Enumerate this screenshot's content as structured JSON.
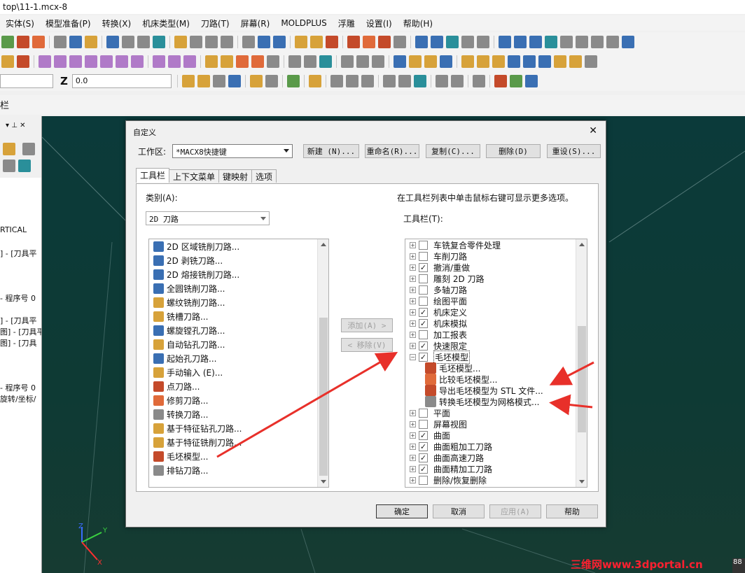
{
  "title": "top\\11-1.mcx-8",
  "menu": [
    "实体(S)",
    "模型准备(P)",
    "转换(X)",
    "机床类型(M)",
    "刀路(T)",
    "屏幕(R)",
    "MOLDPLUS",
    "浮雕",
    "设置(I)",
    "帮助(H)"
  ],
  "toolbar3": {
    "z_label": "Z",
    "z_value": "0.0"
  },
  "toolbar_strip_label": "栏",
  "left_panel": {
    "items": [
      "RTICAL",
      "]  - [刀具平",
      "- 程序号 0",
      "]  - [刀具平",
      "图] - [刀具平",
      "图] - [刀具",
      "- 程序号 0",
      "旋转/坐标/"
    ]
  },
  "dialog": {
    "title": "自定义",
    "workspace_label": "工作区:",
    "workspace_value": "*MACX8快捷键",
    "buttons": {
      "new": "新建 (N)...",
      "rename": "重命名(R)...",
      "copy": "复制(C)...",
      "delete": "删除(D)",
      "reset": "重设(S)..."
    },
    "tabs": [
      "工具栏",
      "上下文菜单",
      "键映射",
      "选项"
    ],
    "category_label": "类别(A):",
    "category_value": "2D 刀路",
    "hint": "在工具栏列表中单击鼠标右键可显示更多选项。",
    "toolbars_label": "工具栏(T):",
    "add": "添加(A) >",
    "remove": "< 移除(V)",
    "commands": [
      {
        "label": "2D 区域铣削刀路...",
        "icon": "area-mill-icon"
      },
      {
        "label": "2D 剥铣刀路...",
        "icon": "peel-mill-icon"
      },
      {
        "label": "2D 熔接铣削刀路...",
        "icon": "blend-mill-icon"
      },
      {
        "label": "全圆铣削刀路...",
        "icon": "circle-mill-icon"
      },
      {
        "label": "螺纹铣削刀路...",
        "icon": "thread-mill-icon"
      },
      {
        "label": "铣槽刀路...",
        "icon": "slot-mill-icon"
      },
      {
        "label": "螺旋镗孔刀路...",
        "icon": "helix-bore-icon"
      },
      {
        "label": "自动钻孔刀路...",
        "icon": "auto-drill-icon"
      },
      {
        "label": "起始孔刀路...",
        "icon": "start-hole-icon"
      },
      {
        "label": "手动输入 (E)...",
        "icon": "manual-entry-icon"
      },
      {
        "label": "点刀路...",
        "icon": "point-toolpath-icon"
      },
      {
        "label": "修剪刀路...",
        "icon": "trim-toolpath-icon"
      },
      {
        "label": "转换刀路...",
        "icon": "transform-toolpath-icon"
      },
      {
        "label": "基于特征钻孔刀路...",
        "icon": "fbm-drill-icon"
      },
      {
        "label": "基于特征铣削刀路...",
        "icon": "fbm-mill-icon"
      },
      {
        "label": "毛坯模型...",
        "icon": "stock-model-icon"
      },
      {
        "label": "排钻刀路...",
        "icon": "gang-drill-icon"
      }
    ],
    "toolbars": [
      {
        "label": "车铣复合零件处理",
        "checked": false
      },
      {
        "label": "车削刀路",
        "checked": false
      },
      {
        "label": "撤消/重做",
        "checked": true
      },
      {
        "label": "雕刻 2D 刀路",
        "checked": false
      },
      {
        "label": "多轴刀路",
        "checked": false
      },
      {
        "label": "绘图平面",
        "checked": false
      },
      {
        "label": "机床定义",
        "checked": true
      },
      {
        "label": "机床模拟",
        "checked": true
      },
      {
        "label": "加工报表",
        "checked": false
      },
      {
        "label": "快速限定",
        "checked": true
      },
      {
        "label": "毛坯模型",
        "checked": true,
        "expanded": true,
        "selected": true
      },
      {
        "label": "平面",
        "checked": false
      },
      {
        "label": "屏幕视图",
        "checked": false
      },
      {
        "label": "曲面",
        "checked": true
      },
      {
        "label": "曲面粗加工刀路",
        "checked": true
      },
      {
        "label": "曲面高速刀路",
        "checked": true
      },
      {
        "label": "曲面精加工刀路",
        "checked": true
      },
      {
        "label": "删除/恢复删除",
        "checked": false
      }
    ],
    "stock_children": [
      {
        "label": "毛坯模型...",
        "icon": "stock-model-icon"
      },
      {
        "label": "比较毛坯模型...",
        "icon": "compare-stock-icon"
      },
      {
        "label": "导出毛坯模型为 STL 文件...",
        "icon": "export-stl-icon"
      },
      {
        "label": "转换毛坯模型为网格模式...",
        "icon": "convert-mesh-icon"
      }
    ],
    "footer": {
      "ok": "确定",
      "cancel": "取消",
      "apply": "应用(A)",
      "help": "帮助"
    }
  },
  "watermark": "三维网www.3dportal.cn",
  "corner_text": "88"
}
